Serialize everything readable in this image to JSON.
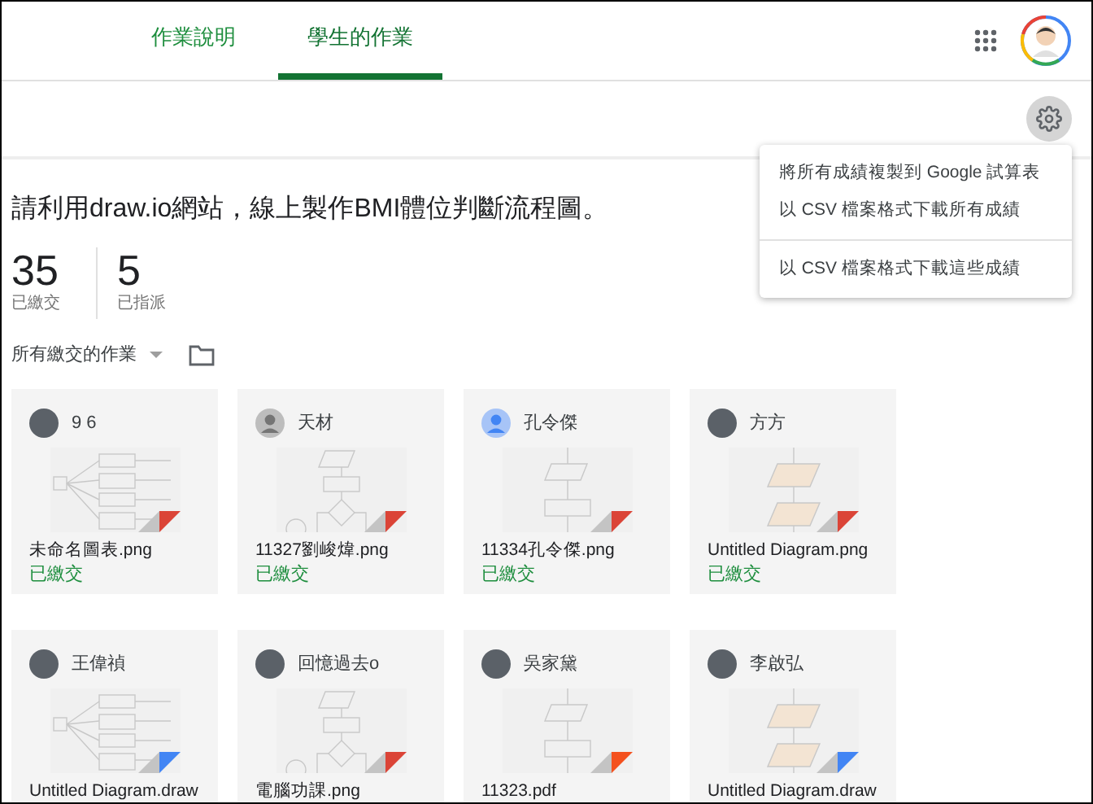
{
  "tabs": [
    {
      "label": "作業說明",
      "selected": false
    },
    {
      "label": "學生的作業",
      "selected": true
    }
  ],
  "assignment": {
    "title": "請利用draw.io網站，線上製作BMI體位判斷流程圖。"
  },
  "stats": [
    {
      "value": "35",
      "label": "已繳交"
    },
    {
      "value": "5",
      "label": "已指派"
    }
  ],
  "filter": {
    "label": "所有繳交的作業"
  },
  "menu": {
    "items": [
      {
        "label": "將所有成績複製到 Google 試算表",
        "divider_after": false
      },
      {
        "label": "以 CSV 檔案格式下載所有成績",
        "divider_after": true
      },
      {
        "label": "以 CSV 檔案格式下載這些成績",
        "divider_after": false
      }
    ]
  },
  "submissions": [
    {
      "student": "9 6",
      "kind": "photo",
      "file": "未命名圖表.png",
      "status": "已繳交",
      "color": "#db4437"
    },
    {
      "student": "天材",
      "kind": "default",
      "file": "11327劉峻煒.png",
      "status": "已繳交",
      "color": "#db4437"
    },
    {
      "student": "孔令傑",
      "kind": "blue",
      "file": "11334孔令傑.png",
      "status": "已繳交",
      "color": "#db4437"
    },
    {
      "student": "方方",
      "kind": "photo",
      "file": "Untitled Diagram.png",
      "status": "已繳交",
      "color": "#db4437"
    },
    {
      "student": "王偉禎",
      "kind": "photo",
      "file": "Untitled Diagram.draw",
      "color": "#4285f4"
    },
    {
      "student": "回憶過去o",
      "kind": "photo",
      "file": "電腦功課.png",
      "color": "#db4437"
    },
    {
      "student": "吳家黛",
      "kind": "photo",
      "file": "11323.pdf",
      "color": "#f4511e"
    },
    {
      "student": "李啟弘",
      "kind": "photo",
      "file": "Untitled Diagram.draw",
      "color": "#4285f4"
    }
  ]
}
